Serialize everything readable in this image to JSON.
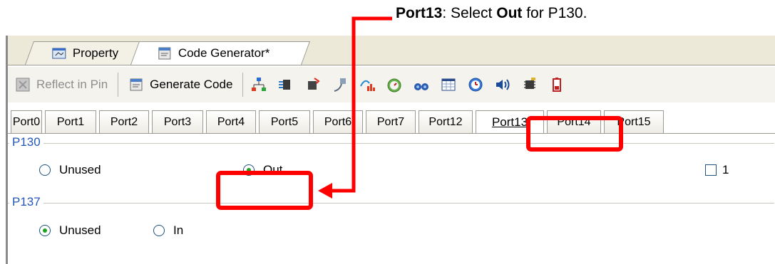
{
  "caption": {
    "port": "Port13",
    "mid": ": Select ",
    "out": "Out",
    "tail": " for P130."
  },
  "doc_tabs": [
    {
      "label": "Property"
    },
    {
      "label": "Code Generator*"
    }
  ],
  "toolbar": {
    "reflect_label": "Reflect in Pin",
    "generate_label": "Generate Code",
    "icons": [
      "tree-icon",
      "serial-icon",
      "chip-icon",
      "plug-icon",
      "chart-icon",
      "timer-icon",
      "binoculars-icon",
      "grid-icon",
      "clock-icon",
      "sound-icon",
      "board-icon",
      "battery-icon"
    ]
  },
  "port_tabs": [
    "Port0",
    "Port1",
    "Port2",
    "Port3",
    "Port4",
    "Port5",
    "Port6",
    "Port7",
    "Port12",
    "Port13",
    "Port14",
    "Port15"
  ],
  "active_port_tab": "Port13",
  "groups": [
    {
      "name": "P130",
      "options": [
        {
          "label": "Unused",
          "selected": false
        },
        {
          "label": "Out",
          "selected": true
        }
      ],
      "checkbox_label": "1"
    },
    {
      "name": "P137",
      "options": [
        {
          "label": "Unused",
          "selected": true
        },
        {
          "label": "In",
          "selected": false
        }
      ]
    }
  ],
  "colors": {
    "highlight": "#ff0000",
    "group_label": "#2458b8",
    "window_bg": "#ece9d8"
  }
}
